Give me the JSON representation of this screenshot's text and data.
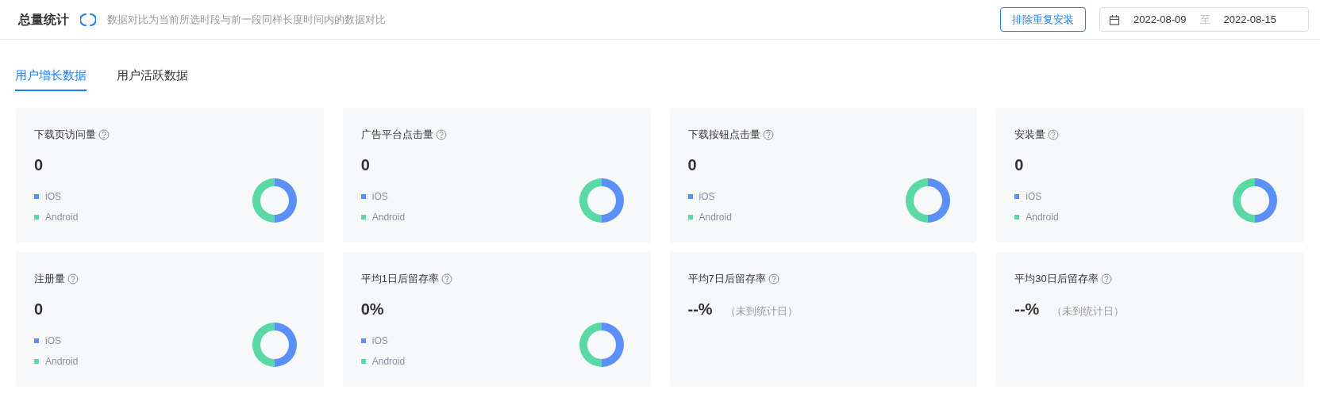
{
  "header": {
    "title": "总量统计",
    "description": "数据对比为当前所选时段与前一段同样长度时间内的数据对比",
    "exclude_button": "排除重复安装",
    "date_range": {
      "start": "2022-08-09",
      "separator": "至",
      "end": "2022-08-15"
    }
  },
  "tabs": [
    {
      "label": "用户增长数据",
      "selected": true
    },
    {
      "label": "用户活跃数据",
      "selected": false
    }
  ],
  "cards": [
    {
      "kind": "donut",
      "title": "下载页访问量",
      "value": "0",
      "legend": [
        {
          "label": "iOS",
          "color": "#5b8ff9"
        },
        {
          "label": "Android",
          "color": "#5ad8a6"
        }
      ]
    },
    {
      "kind": "donut",
      "title": "广告平台点击量",
      "value": "0",
      "legend": [
        {
          "label": "iOS",
          "color": "#5b8ff9"
        },
        {
          "label": "Android",
          "color": "#5ad8a6"
        }
      ]
    },
    {
      "kind": "donut",
      "title": "下载按钮点击量",
      "value": "0",
      "legend": [
        {
          "label": "iOS",
          "color": "#5b8ff9"
        },
        {
          "label": "Android",
          "color": "#5ad8a6"
        }
      ]
    },
    {
      "kind": "donut",
      "title": "安装量",
      "value": "0",
      "legend": [
        {
          "label": "iOS",
          "color": "#5b8ff9"
        },
        {
          "label": "Android",
          "color": "#5ad8a6"
        }
      ]
    },
    {
      "kind": "donut",
      "title": "注册量",
      "value": "0",
      "legend": [
        {
          "label": "iOS",
          "color": "#5b8ff9"
        },
        {
          "label": "Android",
          "color": "#5ad8a6"
        }
      ]
    },
    {
      "kind": "donut",
      "title": "平均1日后留存率",
      "value": "0%",
      "legend": [
        {
          "label": "iOS",
          "color": "#5b8ff9"
        },
        {
          "label": "Android",
          "color": "#5ad8a6"
        }
      ]
    },
    {
      "kind": "pending",
      "title": "平均7日后留存率",
      "value": "--%",
      "note": "（未到统计日）"
    },
    {
      "kind": "pending",
      "title": "平均30日后留存率",
      "value": "--%",
      "note": "（未到统计日）"
    }
  ]
}
